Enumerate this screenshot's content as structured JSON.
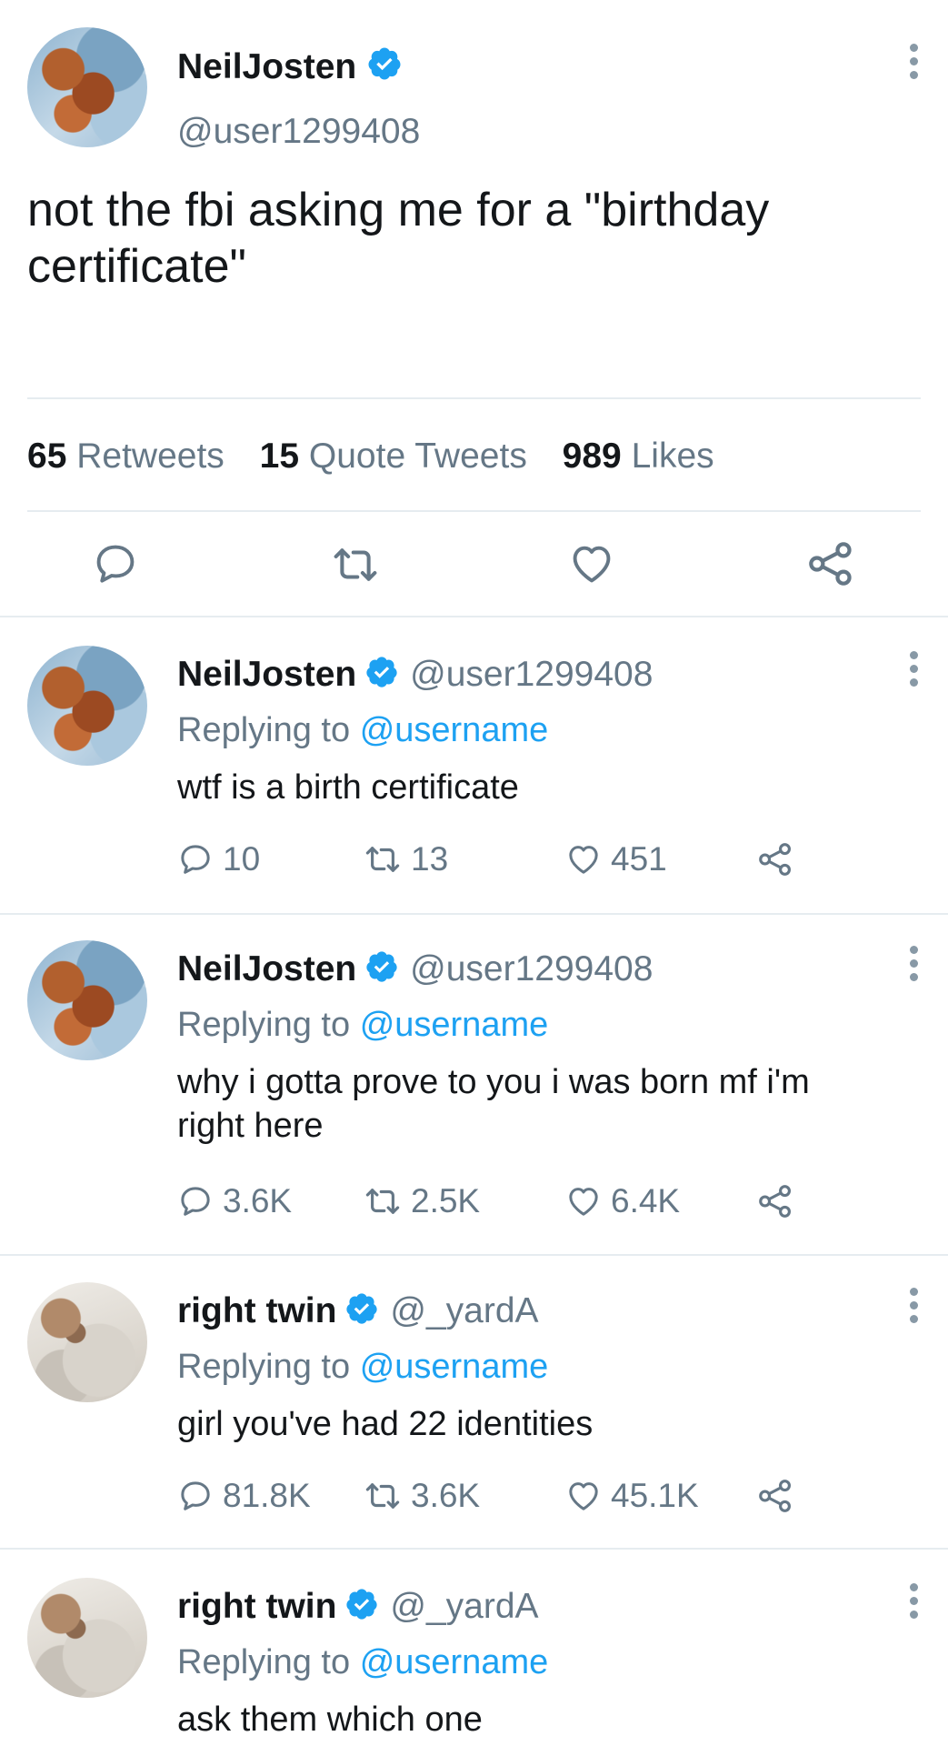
{
  "main_tweet": {
    "display_name": "NeilJosten",
    "handle": "@user1299408",
    "text_line1": "not the fbi asking me for a \"birthday",
    "text_line2": "certificate\"",
    "retweets_count": "65",
    "retweets_label": "Retweets",
    "quotes_count": "15",
    "quotes_label": "Quote Tweets",
    "likes_count": "989",
    "likes_label": "Likes"
  },
  "replies": [
    {
      "display_name": "NeilJosten",
      "handle": "@user1299408",
      "replying_prefix": "Replying to",
      "replying_to": "@username",
      "text_line1": "wtf is a birth certificate",
      "text_line2": "",
      "replies": "10",
      "retweets": "13",
      "likes": "451"
    },
    {
      "display_name": "NeilJosten",
      "handle": "@user1299408",
      "replying_prefix": "Replying to",
      "replying_to": "@username",
      "text_line1": "why i gotta prove to you i was born mf i'm",
      "text_line2": "right here",
      "replies": "3.6K",
      "retweets": "2.5K",
      "likes": "6.4K"
    },
    {
      "display_name": "right twin",
      "handle": "@_yardA",
      "replying_prefix": "Replying to",
      "replying_to": "@username",
      "text_line1": "girl you've had 22 identities",
      "text_line2": "",
      "replies": "81.8K",
      "retweets": "3.6K",
      "likes": "45.1K"
    },
    {
      "display_name": "right twin",
      "handle": "@_yardA",
      "replying_prefix": "Replying to",
      "replying_to": "@username",
      "text_line1": "ask them which one",
      "text_line2": ""
    }
  ],
  "icons": {
    "verified": "verified-badge-icon",
    "reply": "reply-icon",
    "retweet": "retweet-icon",
    "like": "heart-icon",
    "share": "share-icon",
    "more": "more-options-icon"
  },
  "colors": {
    "accent": "#1da1f2",
    "secondary_text": "#657786",
    "primary_text": "#14171a",
    "divider": "#e6ecf0"
  }
}
